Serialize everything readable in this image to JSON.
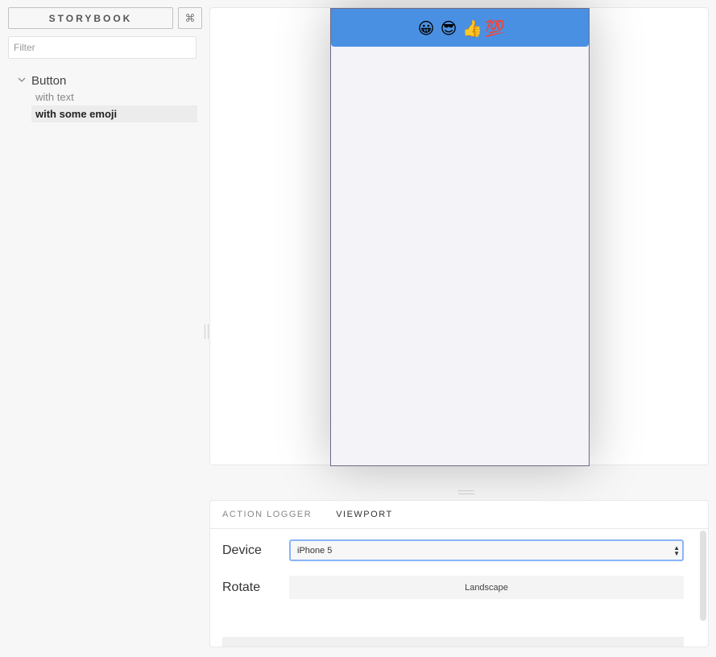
{
  "sidebar": {
    "title": "STORYBOOK",
    "shortcut_icon": "command-icon",
    "shortcut_glyph": "⌘",
    "filter_placeholder": "Filter",
    "filter_value": "",
    "kinds": [
      {
        "label": "Button",
        "expanded": true,
        "stories": [
          {
            "label": "with text",
            "active": false
          },
          {
            "label": "with some emoji",
            "active": true
          }
        ]
      }
    ]
  },
  "preview": {
    "button_emojis": [
      "😀",
      "😎",
      "👍",
      "💯"
    ],
    "button_color": "#4a90e2",
    "device_bg": "#f3f3f8"
  },
  "addons": {
    "tabs": [
      {
        "label": "ACTION LOGGER",
        "active": false
      },
      {
        "label": "VIEWPORT",
        "active": true
      }
    ],
    "device_label": "Device",
    "device_value": "iPhone 5",
    "rotate_label": "Rotate",
    "rotate_button": "Landscape"
  },
  "colors": {
    "accent": "#4a90e2",
    "focus_ring": "#8ab4f8"
  }
}
